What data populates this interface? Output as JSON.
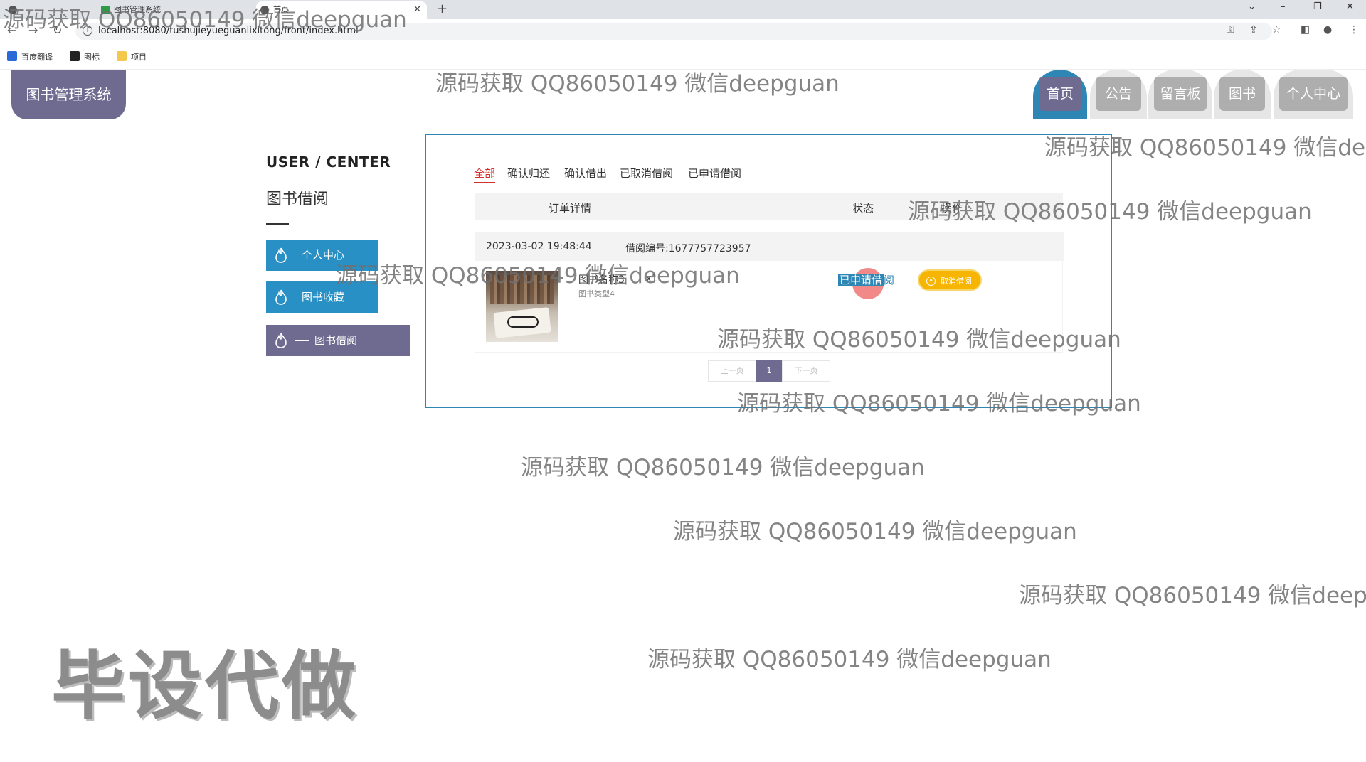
{
  "browser": {
    "tabs": [
      {
        "label": ""
      },
      {
        "label": "图书管理系统"
      },
      {
        "label": "首页"
      }
    ],
    "new_tab": "+",
    "url": "localhost:8080/tushujieyueguanlixitong/front/index.html",
    "bookmarks": [
      {
        "label": "百度翻译"
      },
      {
        "label": "图标"
      },
      {
        "label": "项目"
      }
    ]
  },
  "site": {
    "logo": "图书管理系统",
    "nav": [
      {
        "label": "首页",
        "active": true
      },
      {
        "label": "公告",
        "active": false
      },
      {
        "label": "留言板",
        "active": false
      },
      {
        "label": "图书",
        "active": false
      },
      {
        "label": "个人中心",
        "active": false
      }
    ]
  },
  "sidebar": {
    "title": "USER / CENTER",
    "subtitle": "图书借阅",
    "items": [
      {
        "label": "个人中心"
      },
      {
        "label": "图书收藏"
      },
      {
        "label": "图书借阅"
      }
    ]
  },
  "orders": {
    "tabs": [
      {
        "label": "全部",
        "active": true
      },
      {
        "label": "确认归还",
        "active": false
      },
      {
        "label": "确认借出",
        "active": false
      },
      {
        "label": "已取消借阅",
        "active": false
      },
      {
        "label": "已申请借阅",
        "active": false
      }
    ],
    "columns": {
      "detail": "订单详情",
      "status": "状态",
      "action": "操作"
    },
    "rows": [
      {
        "date": "2023-03-02 19:48:44",
        "order_no": "借阅编号:1677757723957",
        "book_name": "图书名称3",
        "qty": "x1",
        "book_type": "图书类型4",
        "status": "已申请借阅",
        "status_highlight": "已申请借",
        "status_rest": "阅",
        "action": "取消借阅",
        "action_icon": "¥"
      }
    ],
    "pager": {
      "prev": "上一页",
      "current": "1",
      "next": "下一页"
    }
  },
  "watermarks": {
    "text": "源码获取 QQ86050149 微信deepguan",
    "big": "毕设代做"
  },
  "colors": {
    "accent_blue": "#2e86b5",
    "accent_purple": "#6f6a8f",
    "active_tab_red": "#d32f2f",
    "cancel_yellow": "#f7b400"
  }
}
